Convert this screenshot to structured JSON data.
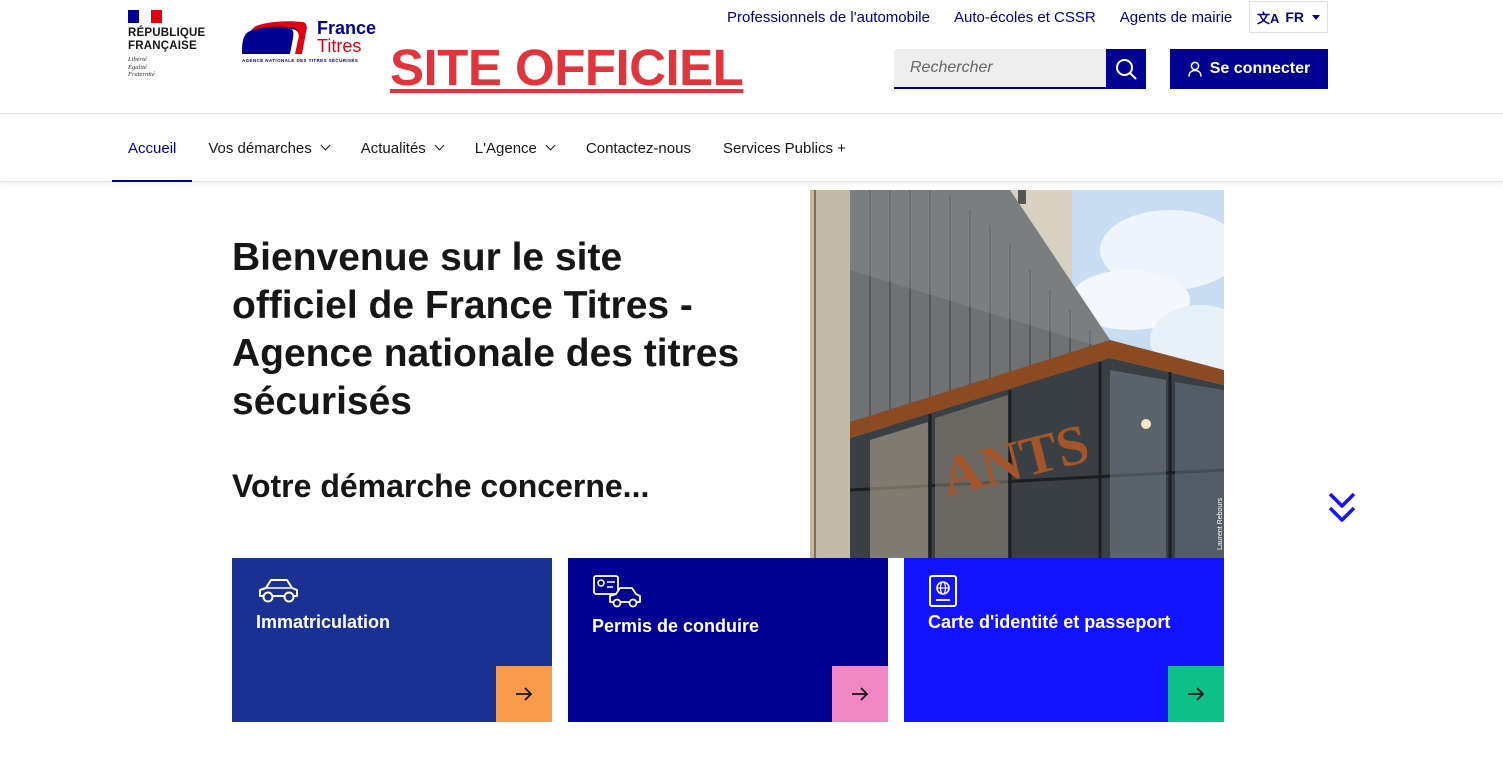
{
  "header": {
    "republic": {
      "line1": "RÉPUBLIQUE",
      "line2": "FRANÇAISE",
      "motto1": "Liberté",
      "motto2": "Égalité",
      "motto3": "Fraternité"
    },
    "brand": {
      "word1": "France",
      "word2": "Titres",
      "tagline": "AGENCE NATIONALE DES TITRES SÉCURISÉS"
    },
    "banner": "SITE OFFICIEL",
    "top_links": [
      "Professionnels de l'automobile",
      "Auto-écoles et CSSR",
      "Agents de mairie"
    ],
    "lang": "FR",
    "search": {
      "placeholder": "Rechercher"
    },
    "connect_label": "Se connecter"
  },
  "nav": {
    "items": [
      {
        "label": "Accueil",
        "active": true,
        "dropdown": false
      },
      {
        "label": "Vos démarches",
        "active": false,
        "dropdown": true
      },
      {
        "label": "Actualités",
        "active": false,
        "dropdown": true
      },
      {
        "label": "L'Agence",
        "active": false,
        "dropdown": true
      },
      {
        "label": "Contactez-nous",
        "active": false,
        "dropdown": false
      },
      {
        "label": "Services Publics +",
        "active": false,
        "dropdown": false
      }
    ]
  },
  "hero": {
    "title": "Bienvenue sur le site officiel de France Titres - Agence nationale des titres sécurisés",
    "subtitle": "Votre démarche concerne...",
    "image_sign": "ANTS",
    "image_credit": "Laurent Rebours"
  },
  "tiles": [
    {
      "label": "Immatriculation",
      "bg": "#1b3192",
      "arrow_bg": "#f79a4a",
      "icon": "car-icon"
    },
    {
      "label": "Permis de conduire",
      "bg": "#000091",
      "arrow_bg": "#f086c4",
      "icon": "license-icon"
    },
    {
      "label": "Carte d'identité et passeport",
      "bg": "#1212ff",
      "arrow_bg": "#0fbf88",
      "icon": "passport-icon"
    }
  ],
  "colors": {
    "primary": "#000091",
    "banner_red": "#e1343c"
  }
}
